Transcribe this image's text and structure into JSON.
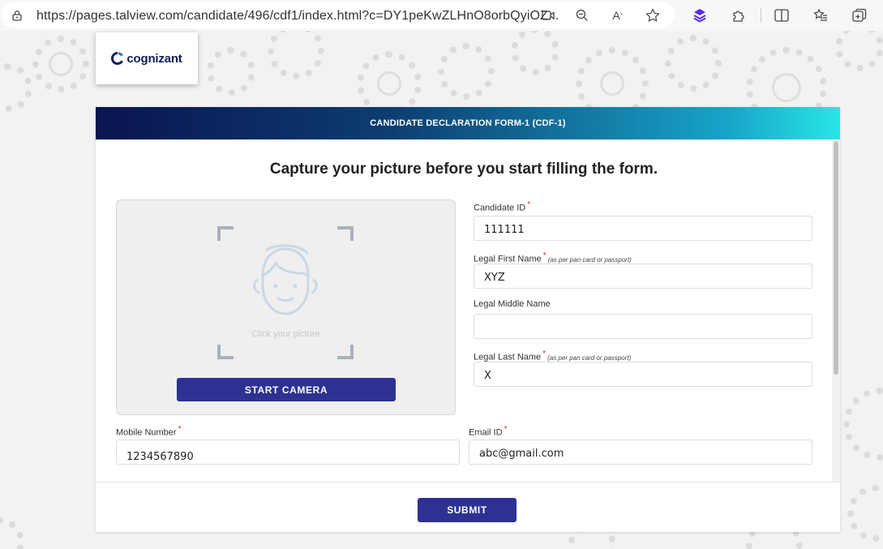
{
  "browser": {
    "url": "https://pages.talview.com/candidate/496/cdf1/index.html?c=DY1peKwZLHnO8orbQyiOZ..."
  },
  "brand": {
    "logo_text": "cognizant",
    "accent": "#2e3192"
  },
  "form": {
    "header_title": "CANDIDATE DECLARATION FORM-1 (CDF-1)",
    "headline": "Capture your picture before you start filling the form.",
    "camera": {
      "hint": "Click your picture",
      "button_label": "START CAMERA"
    },
    "fields": {
      "candidate_id": {
        "label": "Candidate ID",
        "required": "*",
        "value": "111111"
      },
      "first_name": {
        "label": "Legal First Name",
        "required": "*",
        "note": "(as per pan card or passport)",
        "value": "XYZ"
      },
      "middle_name": {
        "label": "Legal Middle Name",
        "value": ""
      },
      "last_name": {
        "label": "Legal Last Name",
        "required": "*",
        "note": "(as per pan card or passport)",
        "value": "X"
      },
      "mobile": {
        "label": "Mobile Number",
        "required": "*",
        "value": "1234567890"
      },
      "email": {
        "label": "Email ID",
        "required": "*",
        "value": "abc@gmail.com"
      }
    },
    "submit_label": "SUBMIT"
  }
}
